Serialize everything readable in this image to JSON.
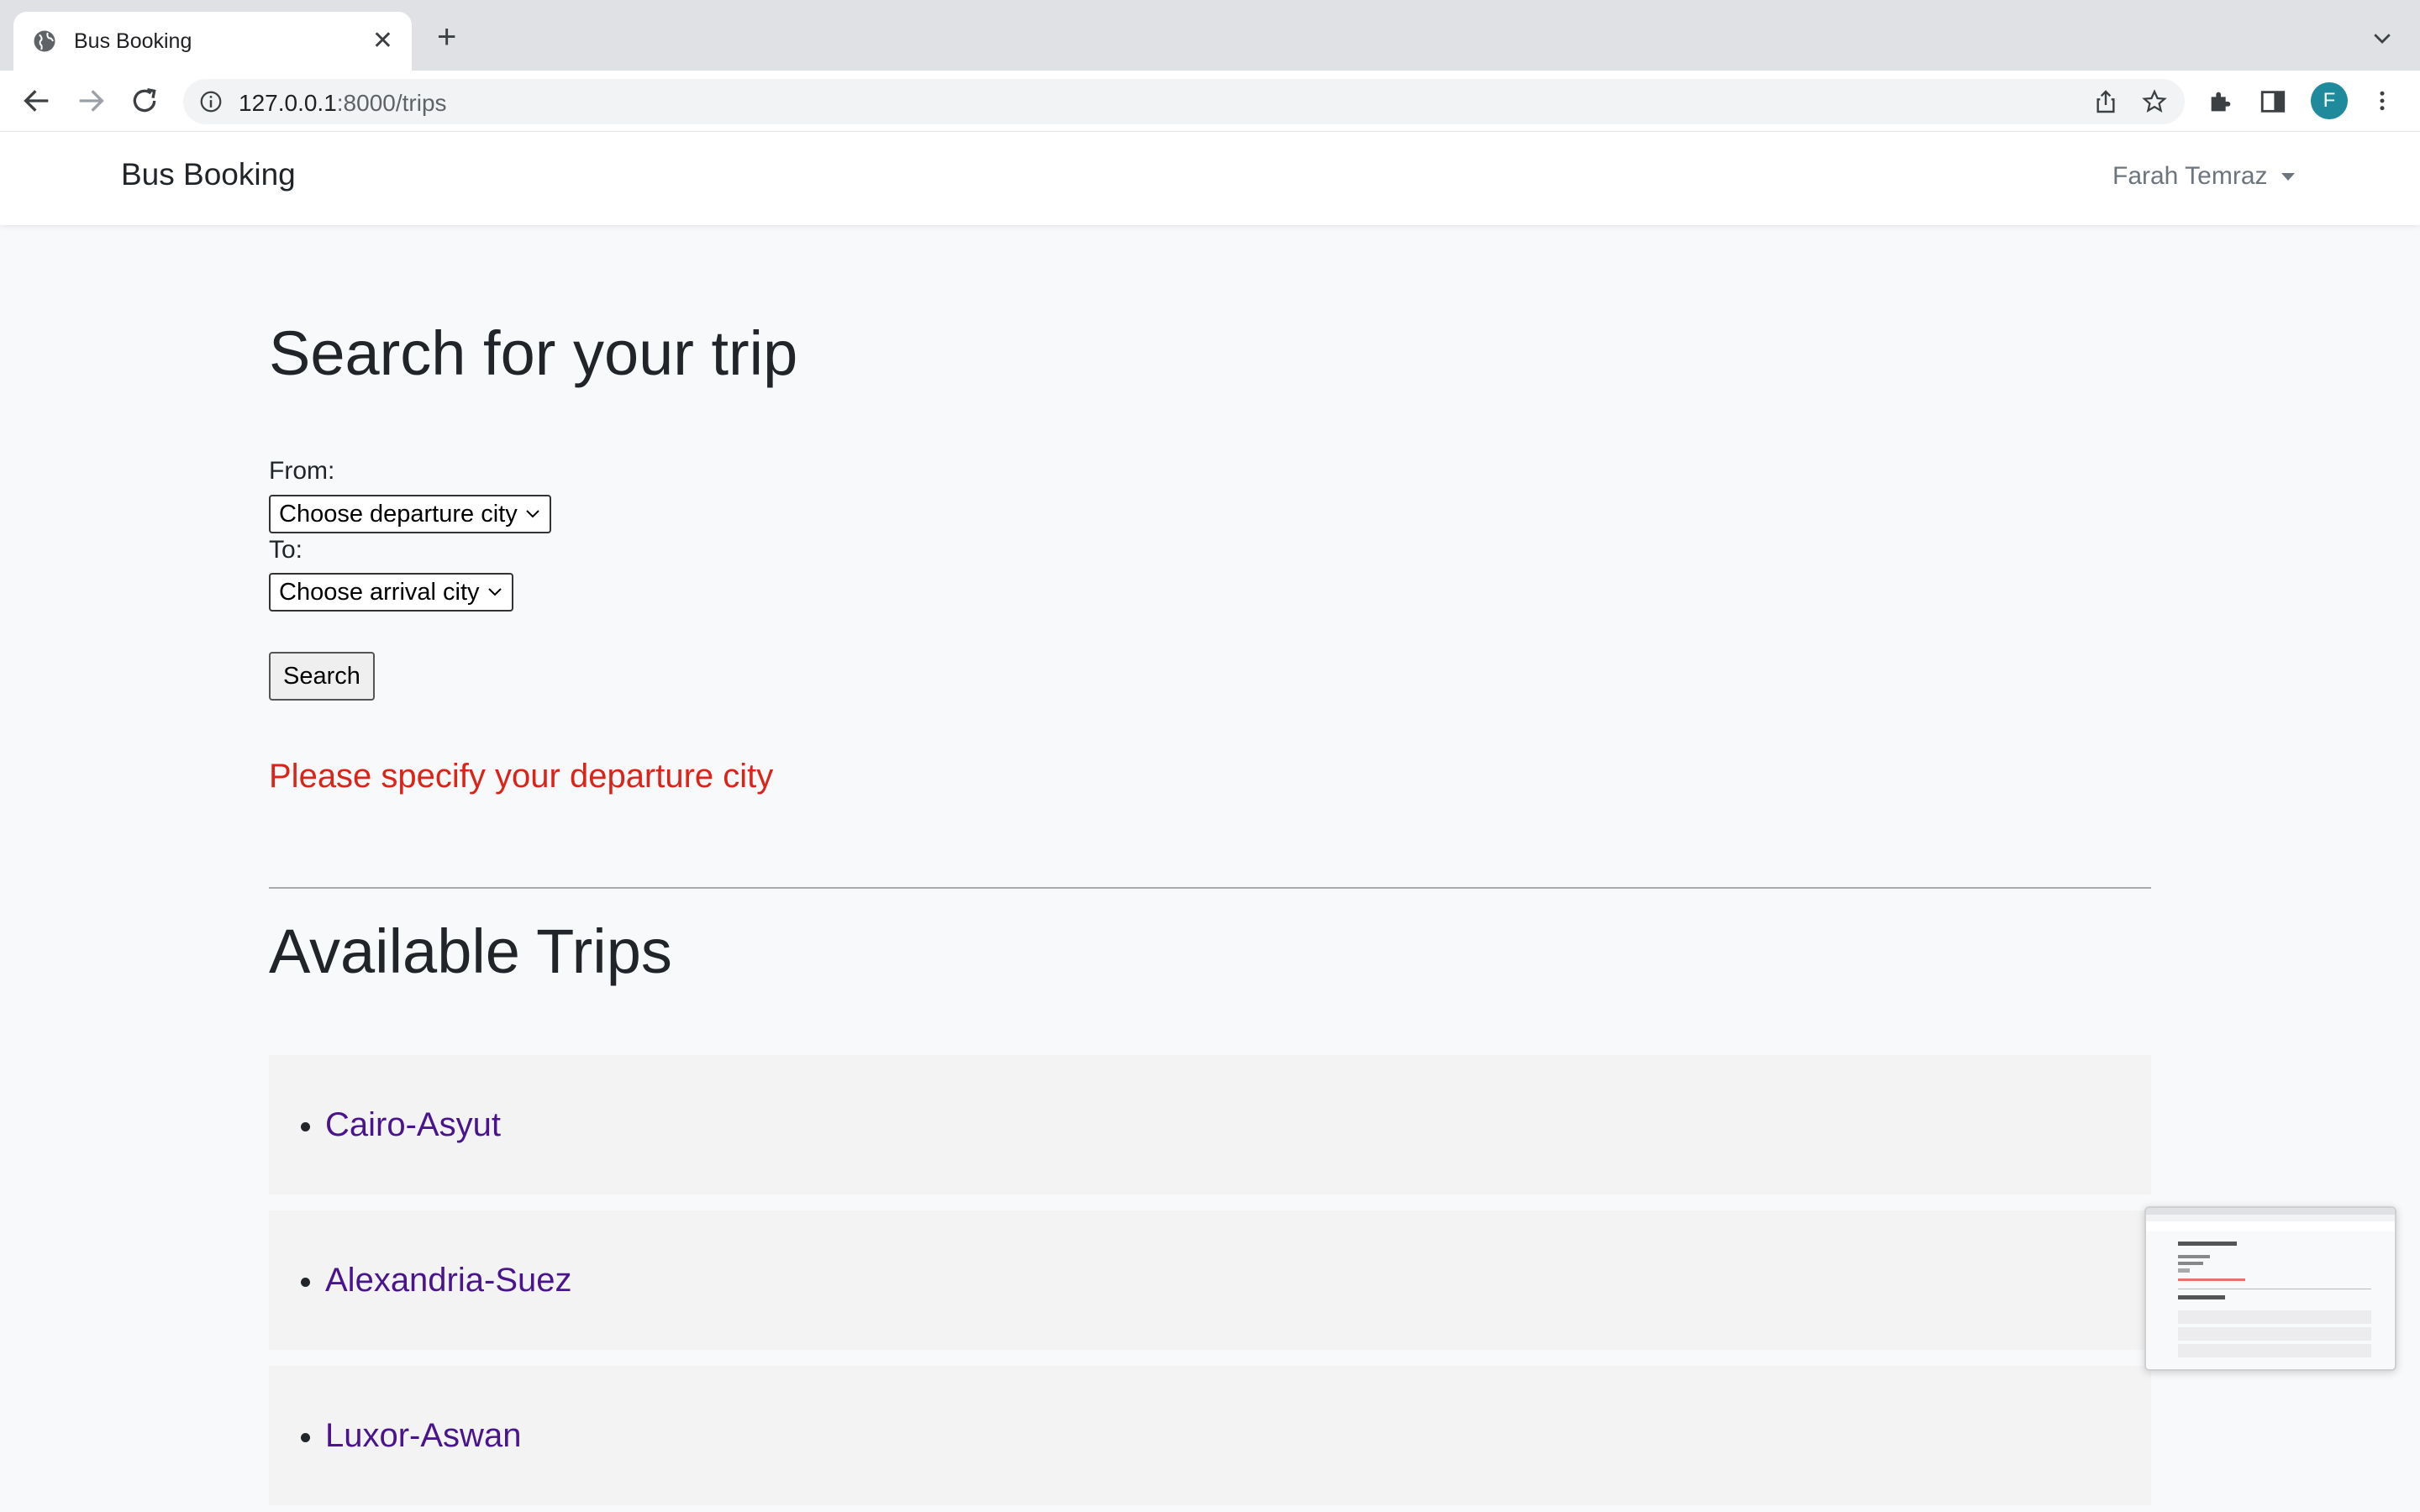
{
  "browser": {
    "tab_title": "Bus Booking",
    "url_host": "127.0.0.1",
    "url_rest": ":8000/trips",
    "profile_initial": "F"
  },
  "navbar": {
    "brand": "Bus Booking",
    "user_name": "Farah Temraz"
  },
  "search": {
    "heading": "Search for your trip",
    "from_label": "From:",
    "from_selected": "Choose departure city",
    "to_label": "To:",
    "to_selected": "Choose arrival city",
    "button_label": "Search",
    "error_message": "Please specify your departure city"
  },
  "trips": {
    "heading": "Available Trips",
    "items": [
      {
        "name": "Cairo-Asyut"
      },
      {
        "name": "Alexandria-Suez"
      },
      {
        "name": "Luxor-Aswan"
      }
    ]
  },
  "colors": {
    "error": "#dc2318",
    "link": "#4a148c",
    "avatar": "#1e8a9b"
  }
}
